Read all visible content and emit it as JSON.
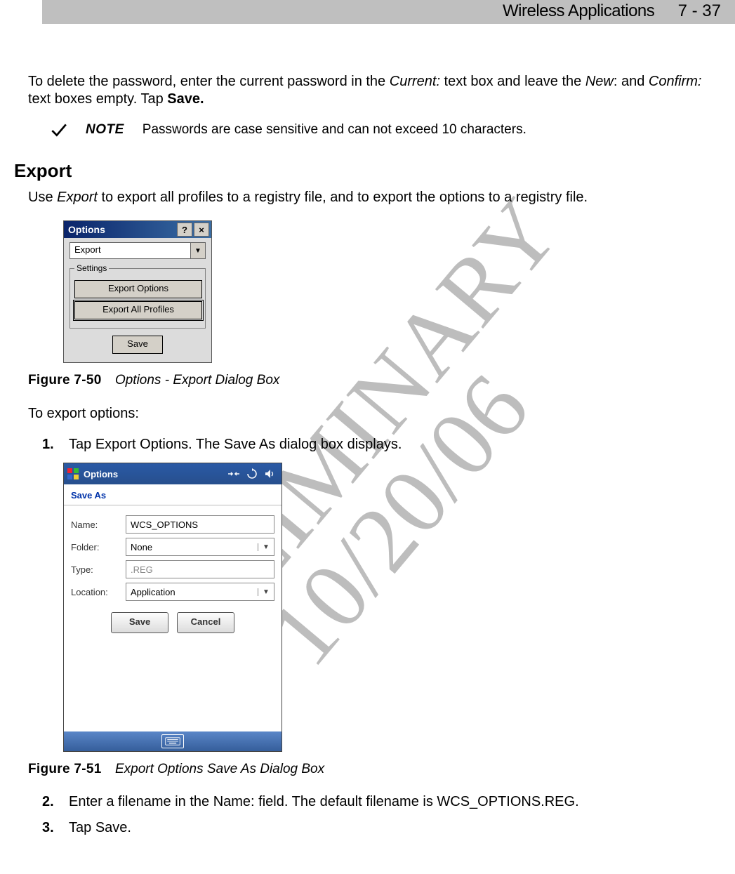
{
  "header": {
    "title": "Wireless Applications",
    "page_ref": "7 - 37"
  },
  "watermark": {
    "line1": "PRELIMINARY",
    "line2": "10/20/06"
  },
  "intro_para": {
    "t1": "To delete the password, enter the current password in the ",
    "i1": "Current:",
    "t2": " text box and leave the ",
    "i2": "New",
    "t3": ": and ",
    "i3": "Confirm:",
    "t4": " text boxes empty. Tap ",
    "b1": "Save."
  },
  "note": {
    "label": "NOTE",
    "text": "Passwords are case sensitive and can not exceed 10 characters."
  },
  "section_heading": "Export",
  "export_para": {
    "t1": "Use ",
    "i1": "Export",
    "t2": " to export all profiles to a registry file, and to export the options to a registry file."
  },
  "fig50": {
    "title": "Options",
    "help": "?",
    "close": "×",
    "combo": "Export",
    "legend": "Settings",
    "btn_export_options": "Export Options",
    "btn_export_all": "Export All Profiles",
    "btn_save": "Save"
  },
  "fig50_caption": {
    "num": "Figure 7-50",
    "title": "Options - Export Dialog Box"
  },
  "text_to_export": "To export options:",
  "step1": {
    "num": "1.",
    "t1": "Tap ",
    "b1": "Export Options",
    "t2": ". The ",
    "i1": "Save As",
    "t3": " dialog box displays."
  },
  "fig51": {
    "topbar_title": "Options",
    "subtitle": "Save As",
    "labels": {
      "name": "Name:",
      "folder": "Folder:",
      "type": "Type:",
      "location": "Location:"
    },
    "values": {
      "name": "WCS_OPTIONS",
      "folder": "None",
      "type": ".REG",
      "location": "Application"
    },
    "btn_save": "Save",
    "btn_cancel": "Cancel"
  },
  "fig51_caption": {
    "num": "Figure 7-51",
    "title": "Export Options Save As Dialog Box"
  },
  "step2": {
    "num": "2.",
    "t1": "Enter a filename in the ",
    "i1": "Name",
    "t2": ": field. The default filename is WCS_OPTIONS.REG."
  },
  "step3": {
    "num": "3.",
    "t1": "Tap ",
    "b1": "Save",
    "t2": "."
  }
}
